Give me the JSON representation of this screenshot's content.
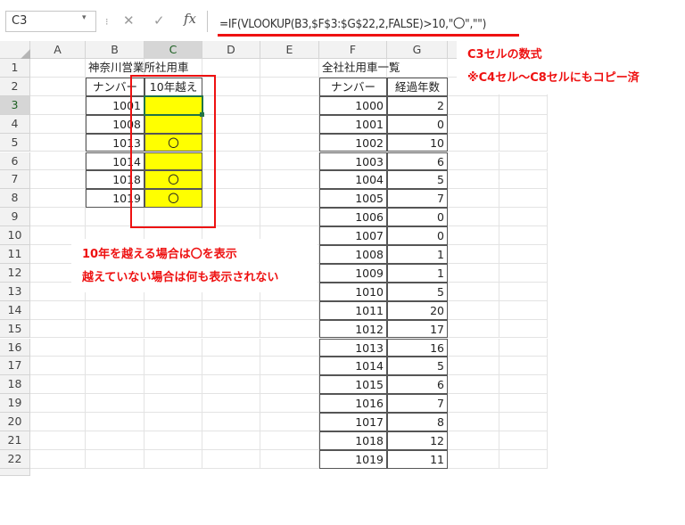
{
  "formula_bar": {
    "name_box": "C3",
    "dropdown_icon": "▾",
    "separator_icon": "⁝",
    "cancel_icon": "✕",
    "enter_icon": "✓",
    "fx_icon": "fx",
    "formula": "=IF(VLOOKUP(B3,$F$3:$G$22,2,FALSE)>10,\"〇\",\"\")"
  },
  "columns": [
    "A",
    "B",
    "C",
    "D",
    "E",
    "F",
    "G"
  ],
  "rows": [
    "1",
    "2",
    "3",
    "4",
    "5",
    "6",
    "7",
    "8",
    "9",
    "10",
    "11",
    "12",
    "13",
    "14",
    "15",
    "16",
    "17",
    "18",
    "19",
    "20",
    "21",
    "22"
  ],
  "left_table": {
    "title": "神奈川営業所社用車",
    "headers": [
      "ナンバー",
      "10年越え"
    ],
    "rows": [
      {
        "number": "1001",
        "over10": ""
      },
      {
        "number": "1008",
        "over10": ""
      },
      {
        "number": "1013",
        "over10": "〇"
      },
      {
        "number": "1014",
        "over10": ""
      },
      {
        "number": "1018",
        "over10": "〇"
      },
      {
        "number": "1019",
        "over10": "〇"
      }
    ]
  },
  "right_table": {
    "title": "全社社用車一覧",
    "headers": [
      "ナンバー",
      "経過年数"
    ],
    "rows": [
      {
        "number": "1000",
        "years": "2"
      },
      {
        "number": "1001",
        "years": "0"
      },
      {
        "number": "1002",
        "years": "10"
      },
      {
        "number": "1003",
        "years": "6"
      },
      {
        "number": "1004",
        "years": "5"
      },
      {
        "number": "1005",
        "years": "7"
      },
      {
        "number": "1006",
        "years": "0"
      },
      {
        "number": "1007",
        "years": "0"
      },
      {
        "number": "1008",
        "years": "1"
      },
      {
        "number": "1009",
        "years": "1"
      },
      {
        "number": "1010",
        "years": "5"
      },
      {
        "number": "1011",
        "years": "20"
      },
      {
        "number": "1012",
        "years": "17"
      },
      {
        "number": "1013",
        "years": "16"
      },
      {
        "number": "1014",
        "years": "5"
      },
      {
        "number": "1015",
        "years": "6"
      },
      {
        "number": "1016",
        "years": "7"
      },
      {
        "number": "1017",
        "years": "8"
      },
      {
        "number": "1018",
        "years": "12"
      },
      {
        "number": "1019",
        "years": "11"
      }
    ]
  },
  "annotations": {
    "formula_note_1": "C3セルの数式",
    "formula_note_2": "※C4セル～C8セルにもコピー済",
    "explain_1": "10年を越える場合は〇を表示",
    "explain_2": "越えていない場合は何も表示されない"
  },
  "colors": {
    "highlight": "#ffff00",
    "annotation": "#ee1111",
    "active_cell": "#217346"
  }
}
